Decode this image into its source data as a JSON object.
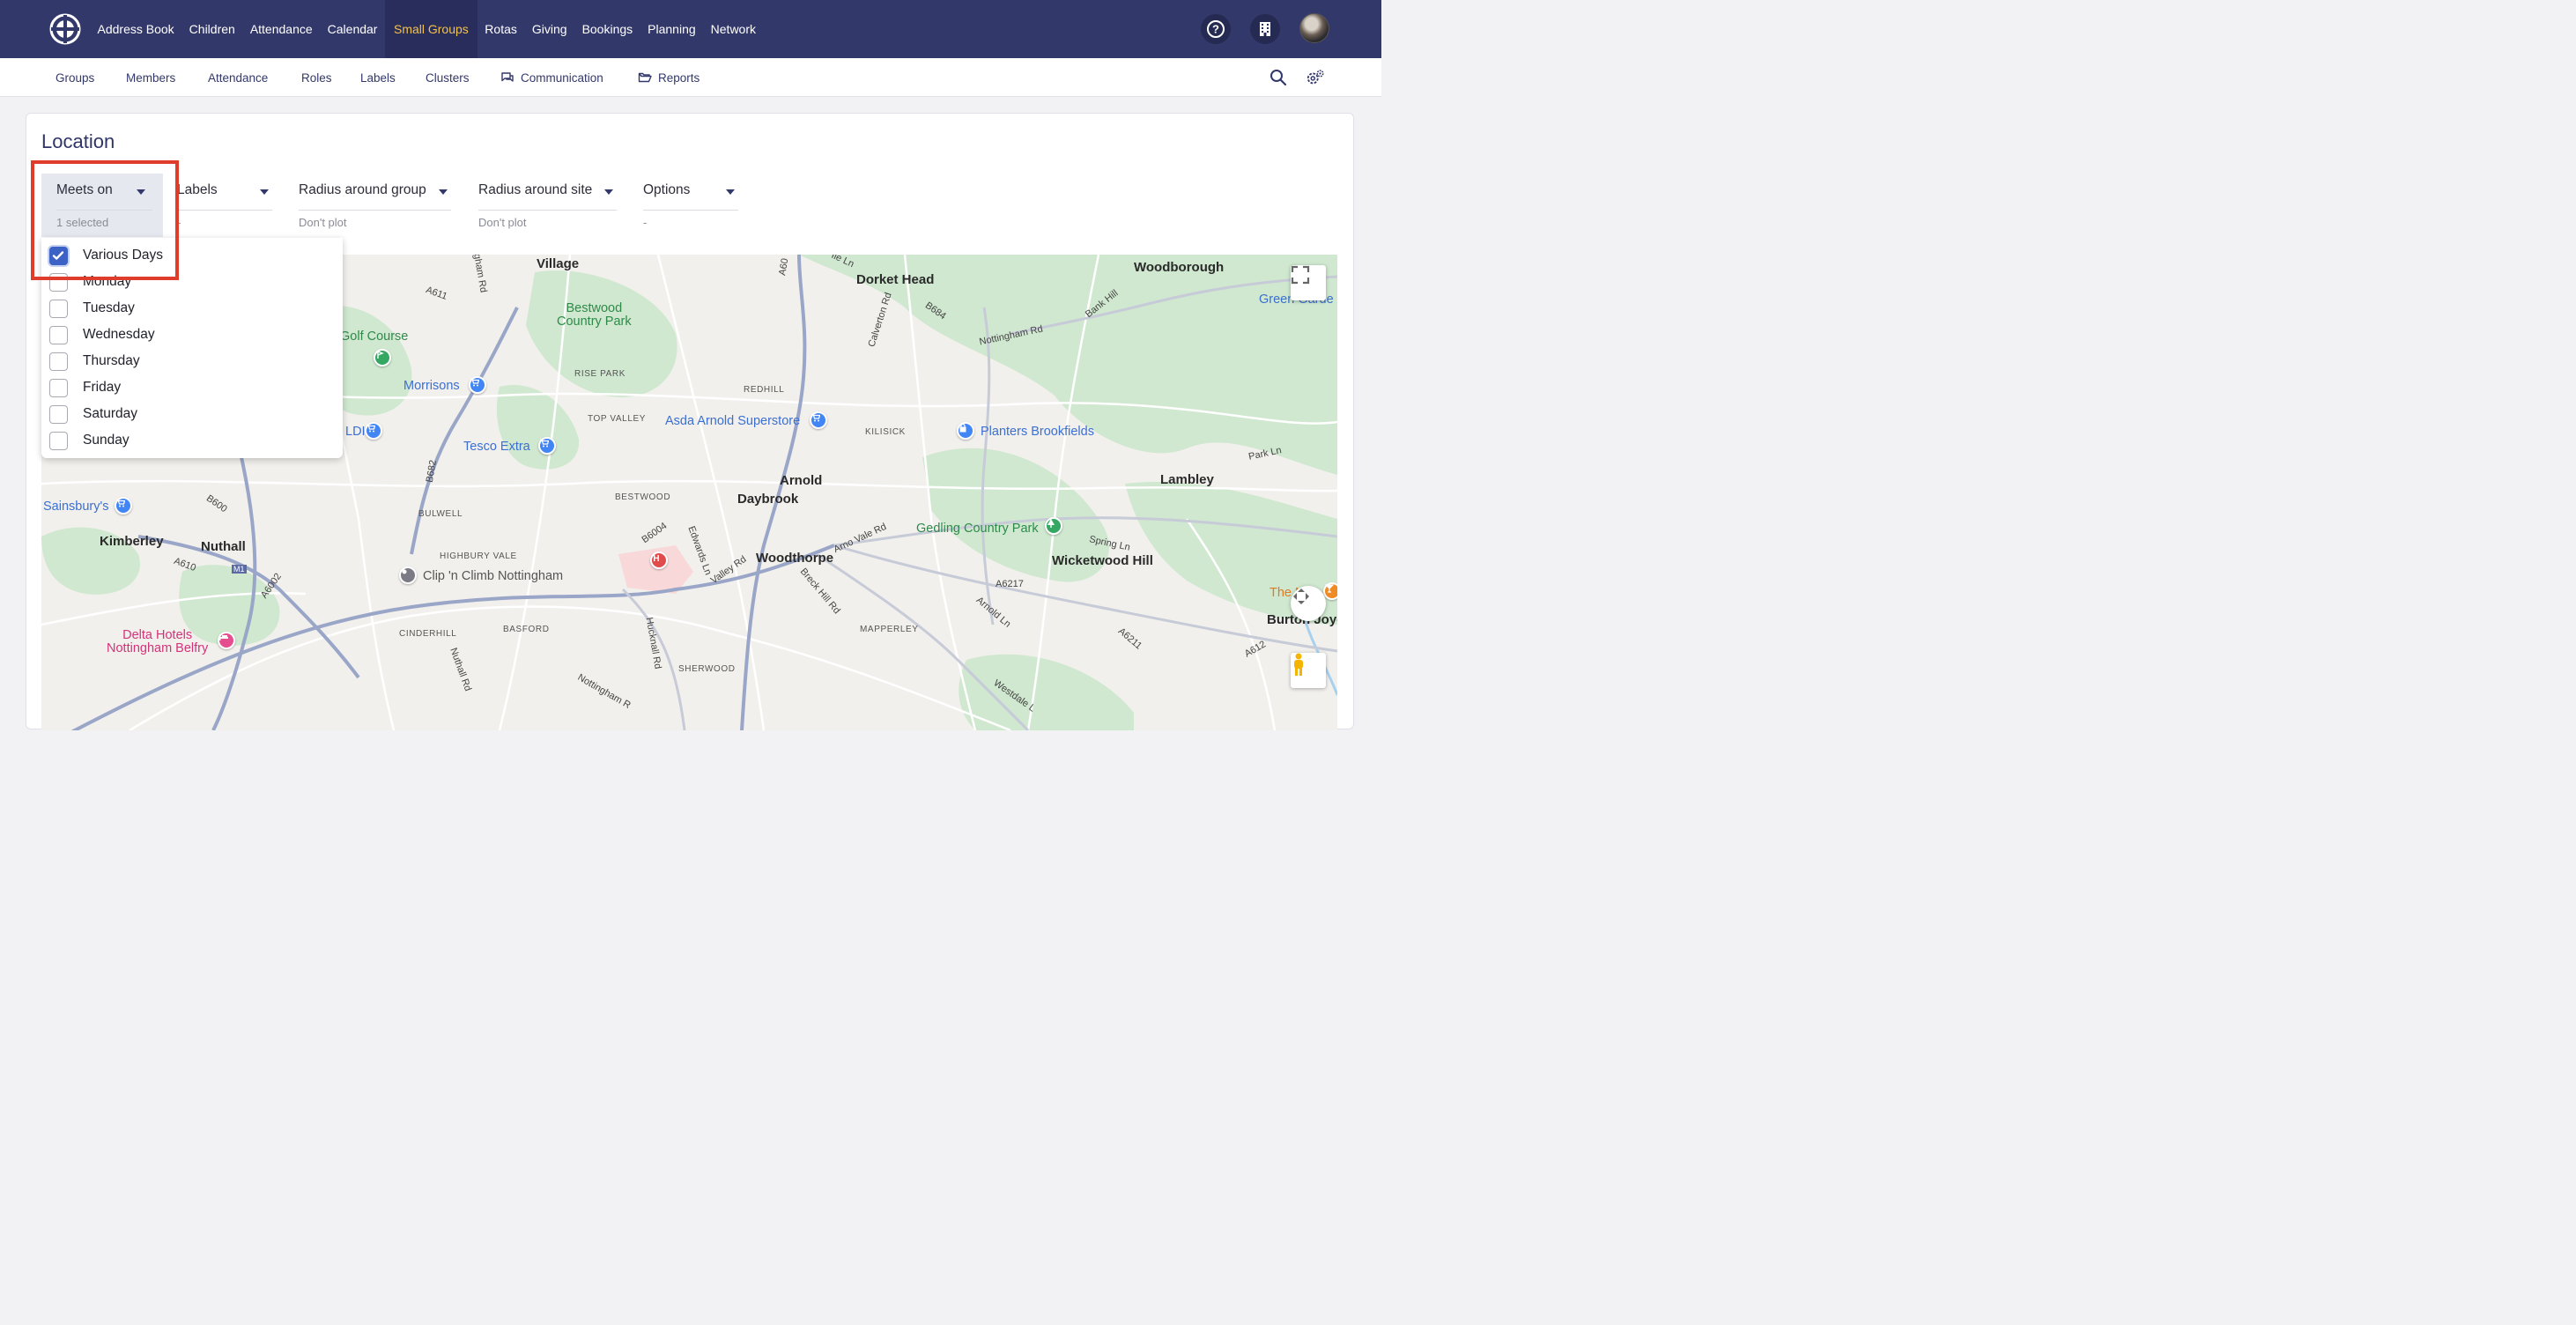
{
  "topnav": {
    "items": [
      "Address Book",
      "Children",
      "Attendance",
      "Calendar",
      "Small Groups",
      "Rotas",
      "Giving",
      "Bookings",
      "Planning",
      "Network"
    ],
    "active_index": 4,
    "icons": [
      "logo-icon",
      "help-icon",
      "building-icon",
      "avatar"
    ]
  },
  "subnav": {
    "items": [
      "Groups",
      "Members",
      "Attendance",
      "Roles",
      "Labels",
      "Clusters",
      "Communication",
      "Reports"
    ],
    "icons": [
      "search-icon",
      "settings-icon"
    ]
  },
  "page": {
    "title": "Location"
  },
  "filters": {
    "meets_on": {
      "label": "Meets on",
      "value": "1 selected"
    },
    "labels": {
      "label": "Labels",
      "value": "-"
    },
    "radius_group": {
      "label": "Radius around group",
      "value": "Don't plot"
    },
    "radius_site": {
      "label": "Radius around site",
      "value": "Don't plot"
    },
    "options": {
      "label": "Options",
      "value": "-"
    }
  },
  "days_dropdown": {
    "options": [
      {
        "label": "Various Days",
        "checked": true
      },
      {
        "label": "Monday",
        "checked": false
      },
      {
        "label": "Tuesday",
        "checked": false
      },
      {
        "label": "Wednesday",
        "checked": false
      },
      {
        "label": "Thursday",
        "checked": false
      },
      {
        "label": "Friday",
        "checked": false
      },
      {
        "label": "Saturday",
        "checked": false
      },
      {
        "label": "Sunday",
        "checked": false
      }
    ]
  },
  "map": {
    "places": [
      "Village",
      "Dorket Head",
      "Woodborough",
      "Arnold",
      "Daybrook",
      "Woodthorpe",
      "Lambley",
      "Wicketwood Hill",
      "Kimberley",
      "Nuthall",
      "Burton Joyc"
    ],
    "areas": [
      "RISE PARK",
      "TOP VALLEY",
      "REDHILL",
      "KILISICK",
      "BESTWOOD",
      "BULWELL",
      "HIGHBURY VALE",
      "CINDERHILL",
      "BASFORD",
      "SHERWOOD",
      "MAPPERLEY"
    ],
    "parks": [
      "Bestwood\nCountry Park",
      "Gedling Country Park",
      "Golf Course",
      "Green Garde"
    ],
    "pois": [
      "Morrisons",
      "Tesco Extra",
      "Asda Arnold Superstore",
      "Planters Brookfields",
      "Sainsbury's",
      "LDI",
      "Clip 'n Climb Nottingham",
      "Delta Hotels\nNottingham Belfry",
      "The Ne"
    ],
    "roads": [
      "A611",
      "A60",
      "B684",
      "Calverton Rd",
      "Nottingham Rd",
      "Bank Hill",
      "B682",
      "B600",
      "A610",
      "A6002",
      "M1",
      "B6004",
      "Edwards Ln",
      "Valley Rd",
      "Hucknall Rd",
      "Arno Vale Rd",
      "Breck Hill Rd",
      "Arnold Ln",
      "A6211",
      "A6217",
      "A612",
      "Park Ln",
      "Spring Ln",
      "Nuthall Rd",
      "Nottingham R",
      "Westdale L",
      "ngham Rd",
      "Ile Ln"
    ]
  }
}
